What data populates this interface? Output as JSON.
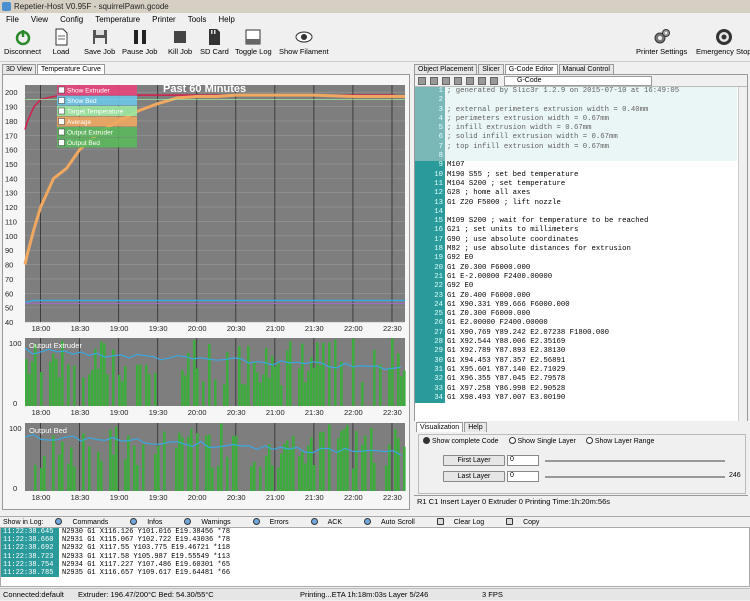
{
  "window": {
    "title": "Repetier-Host V0.95F - squirrelPawn.gcode"
  },
  "menu": [
    "File",
    "View",
    "Config",
    "Temperature",
    "Printer",
    "Tools",
    "Help"
  ],
  "toolbar": {
    "disconnect": "Disconnect",
    "load": "Load",
    "save_job": "Save Job",
    "pause_job": "Pause Job",
    "kill_job": "Kill Job",
    "sd_card": "SD Card",
    "toggle_log": "Toggle Log",
    "show_filament": "Show Filament",
    "printer_settings": "Printer Settings",
    "emergency_stop": "Emergency Stop"
  },
  "left_tabs": [
    "3D View",
    "Temperature Curve"
  ],
  "right_tabs": [
    "Object Placement",
    "Slicer",
    "G-Code Editor",
    "Manual Control"
  ],
  "temp_chart": {
    "title": "Past 60 Minutes",
    "legend": [
      "Show Extruder",
      "Show Bed",
      "Target Temperature",
      "Average",
      "Output Extruder",
      "Output Bed"
    ],
    "legend_colors": [
      "#e8467c",
      "#6ec5e8",
      "#9fe8a0",
      "#f0a860",
      "#5cb85c",
      "#5cb85c"
    ],
    "y_ticks": [
      200,
      190,
      180,
      170,
      160,
      150,
      140,
      130,
      120,
      110,
      100,
      90,
      80,
      70,
      60,
      50,
      40,
      30
    ],
    "x_ticks": [
      "18:00",
      "18:30",
      "19:00",
      "19:30",
      "20:00",
      "20:30",
      "21:00",
      "21:30",
      "22:00",
      "22:30"
    ],
    "output_extruder_label": "Output Extruder",
    "output_bed_label": "Output Bed",
    "sub_y_top": "100",
    "sub_y_bottom": "0"
  },
  "chart_data": {
    "type": "line",
    "title": "Past 60 Minutes",
    "x": [
      "17:48",
      "17:50",
      "17:55",
      "18:00",
      "18:10",
      "18:20",
      "18:30",
      "18:45",
      "19:00",
      "19:15",
      "19:30",
      "19:45",
      "20:00",
      "20:15",
      "20:30",
      "20:45",
      "21:00",
      "21:30",
      "22:00",
      "22:30",
      "22:40"
    ],
    "series": [
      {
        "name": "Show Extruder",
        "values": [
          174,
          180,
          190,
          195,
          197,
          198,
          198,
          198,
          198,
          198,
          198,
          198,
          198,
          198,
          198,
          198,
          198,
          198,
          198,
          198,
          197
        ]
      },
      {
        "name": "Average",
        "values": [
          80,
          88,
          105,
          120,
          140,
          147,
          160,
          172,
          180,
          187,
          192,
          196,
          197,
          197,
          198,
          198,
          198,
          198,
          197,
          197,
          197
        ]
      },
      {
        "name": "Show Bed",
        "values": [
          54,
          54,
          55,
          55,
          55,
          55,
          55,
          55,
          55,
          55,
          55,
          55,
          55,
          55,
          55,
          55,
          55,
          55,
          55,
          55,
          55
        ]
      }
    ],
    "ylim": [
      30,
      205
    ],
    "grid": true,
    "legend": "top-left"
  },
  "gcode": {
    "select_value": "G-Code",
    "lines": [
      {
        "n": "1",
        "t": "; generated by Slic3r 1.2.9 on 2015-07-10 at 16:49:05"
      },
      {
        "n": "2",
        "t": ""
      },
      {
        "n": "3",
        "t": "; external perimeters extrusion width = 0.40mm"
      },
      {
        "n": "4",
        "t": "; perimeters extrusion width = 0.67mm"
      },
      {
        "n": "5",
        "t": "; infill extrusion width = 0.67mm"
      },
      {
        "n": "6",
        "t": "; solid infill extrusion width = 0.67mm"
      },
      {
        "n": "7",
        "t": "; top infill extrusion width = 0.67mm"
      },
      {
        "n": "8",
        "t": ""
      },
      {
        "n": "9",
        "t": "M107"
      },
      {
        "n": "10",
        "t": "M190 S55 ; set bed temperature"
      },
      {
        "n": "11",
        "t": "M104 S200 ; set temperature"
      },
      {
        "n": "12",
        "t": "G28 ; home all axes"
      },
      {
        "n": "13",
        "t": "G1 Z20 F5000 ; lift nozzle"
      },
      {
        "n": "14",
        "t": ""
      },
      {
        "n": "15",
        "t": "M109 S200 ; wait for temperature to be reached"
      },
      {
        "n": "16",
        "t": "G21 ; set units to millimeters"
      },
      {
        "n": "17",
        "t": "G90 ; use absolute coordinates"
      },
      {
        "n": "18",
        "t": "M82 ; use absolute distances for extrusion"
      },
      {
        "n": "19",
        "t": "G92 E0"
      },
      {
        "n": "20",
        "t": "G1 Z0.300 F6000.000"
      },
      {
        "n": "21",
        "t": "G1 E-2.00000 F2400.00000"
      },
      {
        "n": "22",
        "t": "G92 E0"
      },
      {
        "n": "23",
        "t": "G1 Z0.400 F6000.000"
      },
      {
        "n": "24",
        "t": "G1 X90.331 Y89.666 F6000.000"
      },
      {
        "n": "25",
        "t": "G1 Z0.300 F6000.000"
      },
      {
        "n": "26",
        "t": "G1 E2.00000 F2400.00000"
      },
      {
        "n": "27",
        "t": "G1 X90.769 Y89.242 E2.07238 F1800.000"
      },
      {
        "n": "28",
        "t": "G1 X92.544 Y88.006 E2.35169"
      },
      {
        "n": "29",
        "t": "G1 X92.789 Y87.893 E2.38130"
      },
      {
        "n": "30",
        "t": "G1 X94.453 Y87.357 E2.56891"
      },
      {
        "n": "31",
        "t": "G1 X95.601 Y87.140 E2.71029"
      },
      {
        "n": "32",
        "t": "G1 X96.355 Y87.045 E2.79578"
      },
      {
        "n": "33",
        "t": "G1 X97.258 Y86.998 E2.90528"
      },
      {
        "n": "34",
        "t": "G1 X98.493 Y87.007 E3.00190"
      }
    ]
  },
  "visual": {
    "tabs": [
      "Visualization",
      "Help"
    ],
    "options": [
      "Show complete Code",
      "Show Single Layer",
      "Show Layer Range"
    ],
    "first_layer": "First Layer",
    "last_layer": "Last Layer",
    "first_val": "0",
    "last_val": "0",
    "max_label": "246"
  },
  "gstatus": "R1   C1   Insert   Layer 0   Extruder 0   Printing Time:1h:20m:56s",
  "logbar": {
    "show_in_log": "Show in Log:",
    "commands": "Commands",
    "infos": "Infos",
    "warnings": "Warnings",
    "errors": "Errors",
    "ack": "ACK",
    "auto_scroll": "Auto Scroll",
    "clear_log": "Clear Log",
    "copy": "Copy"
  },
  "log": [
    {
      "t": "11:22:38.645",
      "m": "N2930 G1 X116.126 Y101.016 E19.38456 *78"
    },
    {
      "t": "11:22:38.660",
      "m": "N2931 G1 X115.067 Y102.722 E19.43036 *78"
    },
    {
      "t": "11:22:38.692",
      "m": "N2932 G1 X117.55 Y103.775 E19.46721 *118"
    },
    {
      "t": "11:22:38.723",
      "m": "N2933 G1 X117.58 Y105.987 E19.55549 *113"
    },
    {
      "t": "11:22:38.754",
      "m": "N2934 G1 X117.227 Y107.486 E19.60301 *65"
    },
    {
      "t": "11:22:38.785",
      "m": "N2935 G1 X116.657 Y109.617 E19.64481 *66"
    }
  ],
  "statusbar": {
    "connection": "Connected:default",
    "temps": "Extruder: 196.47/200°C Bed: 54.30/55°C",
    "printing": "Printing...ETA 1h:18m:03s Layer 5/246",
    "fps": "3 FPS"
  }
}
